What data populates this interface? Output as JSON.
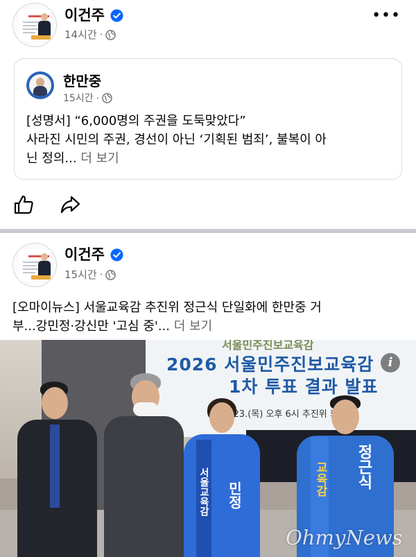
{
  "post1": {
    "author": "이건주",
    "time": "14시간",
    "shared": {
      "author": "한만중",
      "time": "15시간",
      "text_line1": "[성명서] “6,000명의 주권을 도둑맞았다”",
      "text_line2": "사라진 시민의 주권, 경선이 아닌 ‘기획된 범죄’, 불복이 아",
      "text_line3": "닌 정의...",
      "see_more": "더 보기"
    },
    "actions": {
      "like": "like-icon",
      "share": "share-icon"
    }
  },
  "post2": {
    "author": "이건주",
    "time": "15시간",
    "text_line1": "[오마이뉴스] 서울교육감 추진위 정근식 단일화에 한만중 거",
    "text_line2": "부...강민정·강신만 '고심 중'...",
    "see_more": "더 보기",
    "photo": {
      "banner_top": "서울민주진보교육감",
      "banner_line1": "2026 서울민주진보교육감",
      "banner_line2": "1차 투표 결과 발표",
      "banner_line3": "4. 23.(목) 오후 6시  추진위 회",
      "sash_woman": "서울교육감",
      "sash_woman_name": "민정",
      "sash_man": "교육감",
      "sash_man_name": "정근식",
      "watermark": "OhmyNews"
    }
  },
  "colors": {
    "verified": "#0866ff",
    "secondary_text": "#65676b",
    "divider": "#c9ccd1",
    "banner_text": "#1f5aa6",
    "sash": "#2f6fd0"
  }
}
